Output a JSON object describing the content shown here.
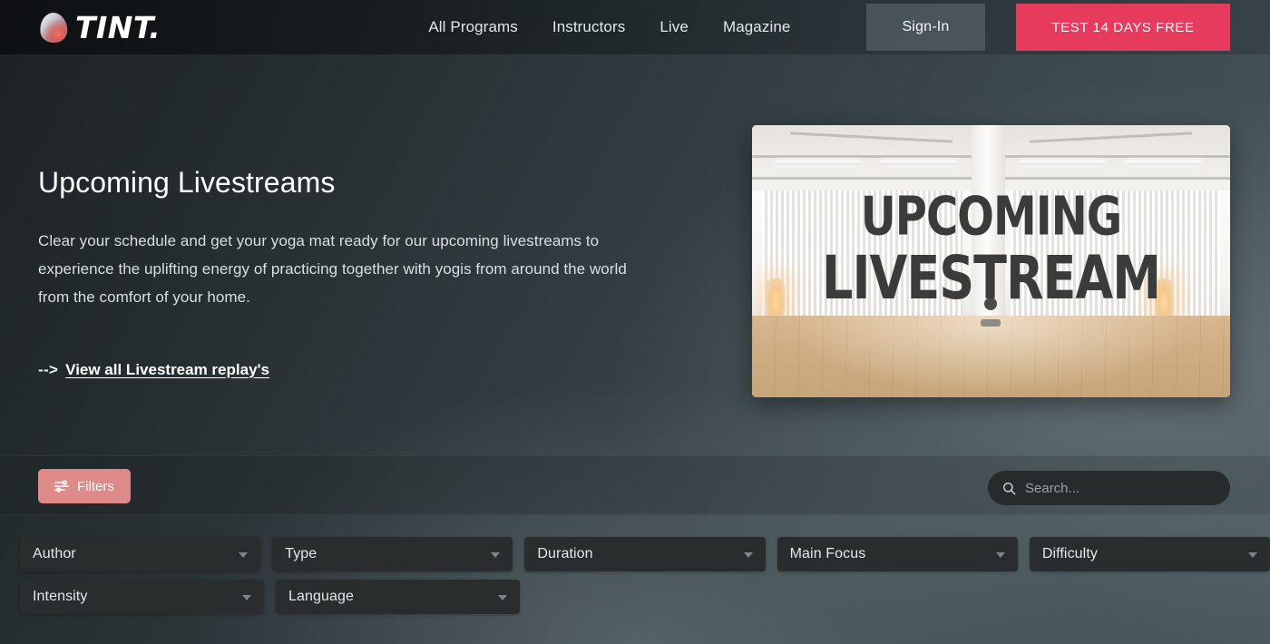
{
  "header": {
    "brand": "TINT.",
    "logo_icon": "tint-droplet-logo",
    "nav": [
      {
        "label": "All Programs",
        "name": "nav-all-programs"
      },
      {
        "label": "Instructors",
        "name": "nav-instructors"
      },
      {
        "label": "Live",
        "name": "nav-live"
      },
      {
        "label": "Magazine",
        "name": "nav-magazine"
      }
    ],
    "signin_label": "Sign-In",
    "trial_label": "TEST 14 DAYS FREE",
    "trial_color": "#e63b5c",
    "signin_color": "#5c686e"
  },
  "hero": {
    "title": "Upcoming Livestreams",
    "description": "Clear your schedule and get your yoga mat ready for our upcoming livestreams to experience the uplifting energy of practicing together with yogis from around the world from the comfort of your home.",
    "arrow": "-->",
    "link_label": "View all Livestream replay's",
    "image": {
      "alt": "Empty bright yoga studio with wooden floor and white curtains",
      "overlay_line1": "UPCOMING",
      "overlay_line2": "LIVESTREAM",
      "overlay_color": "#3b3b3b"
    }
  },
  "toolbar": {
    "filters_label": "Filters",
    "filters_icon": "sliders-icon",
    "filters_color": "#dd8a88",
    "search_placeholder": "Search...",
    "search_value": "",
    "search_icon": "search-icon"
  },
  "filters": {
    "row1": [
      {
        "label": "Author",
        "name": "filter-author"
      },
      {
        "label": "Type",
        "name": "filter-type"
      },
      {
        "label": "Duration",
        "name": "filter-duration"
      },
      {
        "label": "Main Focus",
        "name": "filter-main-focus"
      },
      {
        "label": "Difficulty",
        "name": "filter-difficulty"
      }
    ],
    "row2": [
      {
        "label": "Intensity",
        "name": "filter-intensity"
      },
      {
        "label": "Language",
        "name": "filter-language"
      }
    ]
  }
}
